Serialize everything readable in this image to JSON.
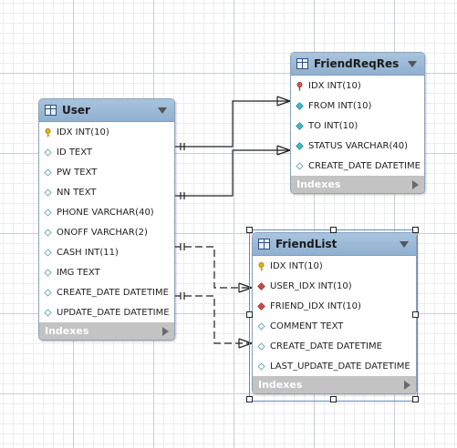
{
  "diagram": {
    "tables": [
      {
        "id": "user",
        "name": "User",
        "footer": "Indexes",
        "columns": [
          {
            "label": "IDX INT(10)",
            "kind": "pk"
          },
          {
            "label": "ID TEXT",
            "kind": "col"
          },
          {
            "label": "PW TEXT",
            "kind": "col"
          },
          {
            "label": "NN TEXT",
            "kind": "col"
          },
          {
            "label": "PHONE VARCHAR(40)",
            "kind": "col"
          },
          {
            "label": "ONOFF VARCHAR(2)",
            "kind": "col"
          },
          {
            "label": "CASH INT(11)",
            "kind": "col"
          },
          {
            "label": "IMG TEXT",
            "kind": "col"
          },
          {
            "label": "CREATE_DATE DATETIME",
            "kind": "col"
          },
          {
            "label": "UPDATE_DATE DATETIME",
            "kind": "col"
          }
        ]
      },
      {
        "id": "friendreqres",
        "name": "FriendReqRes",
        "footer": "Indexes",
        "columns": [
          {
            "label": "IDX INT(10)",
            "kind": "pk-red"
          },
          {
            "label": "FROM INT(10)",
            "kind": "fk-cyan"
          },
          {
            "label": "TO INT(10)",
            "kind": "fk-cyan"
          },
          {
            "label": "STATUS VARCHAR(40)",
            "kind": "fk-cyan"
          },
          {
            "label": "CREATE_DATE DATETIME",
            "kind": "col"
          }
        ]
      },
      {
        "id": "friendlist",
        "name": "FriendList",
        "footer": "Indexes",
        "columns": [
          {
            "label": "IDX INT(10)",
            "kind": "pk"
          },
          {
            "label": "USER_IDX INT(10)",
            "kind": "fk-red"
          },
          {
            "label": "FRIEND_IDX INT(10)",
            "kind": "fk-red"
          },
          {
            "label": "COMMENT TEXT",
            "kind": "col"
          },
          {
            "label": "CREATE_DATE DATETIME",
            "kind": "col"
          },
          {
            "label": "LAST_UPDATE_DATE DATETIME",
            "kind": "col"
          }
        ]
      }
    ],
    "selected_table": "friendlist",
    "colors": {
      "header": "#9bb8d6",
      "footer": "#c3c3c3",
      "line": "#222222",
      "pk_key": "#e6b800",
      "fk_red": "#c84a4a",
      "fk_cyan": "#3fb7c4"
    },
    "relationships": [
      {
        "from": "user",
        "to": "friendreqres",
        "style": "identifying",
        "end": "many"
      },
      {
        "from": "user",
        "to": "friendreqres",
        "style": "identifying",
        "end": "many"
      },
      {
        "from": "user",
        "to": "friendlist",
        "style": "non-identifying",
        "end": "many"
      },
      {
        "from": "user",
        "to": "friendlist",
        "style": "non-identifying",
        "end": "many"
      }
    ]
  }
}
